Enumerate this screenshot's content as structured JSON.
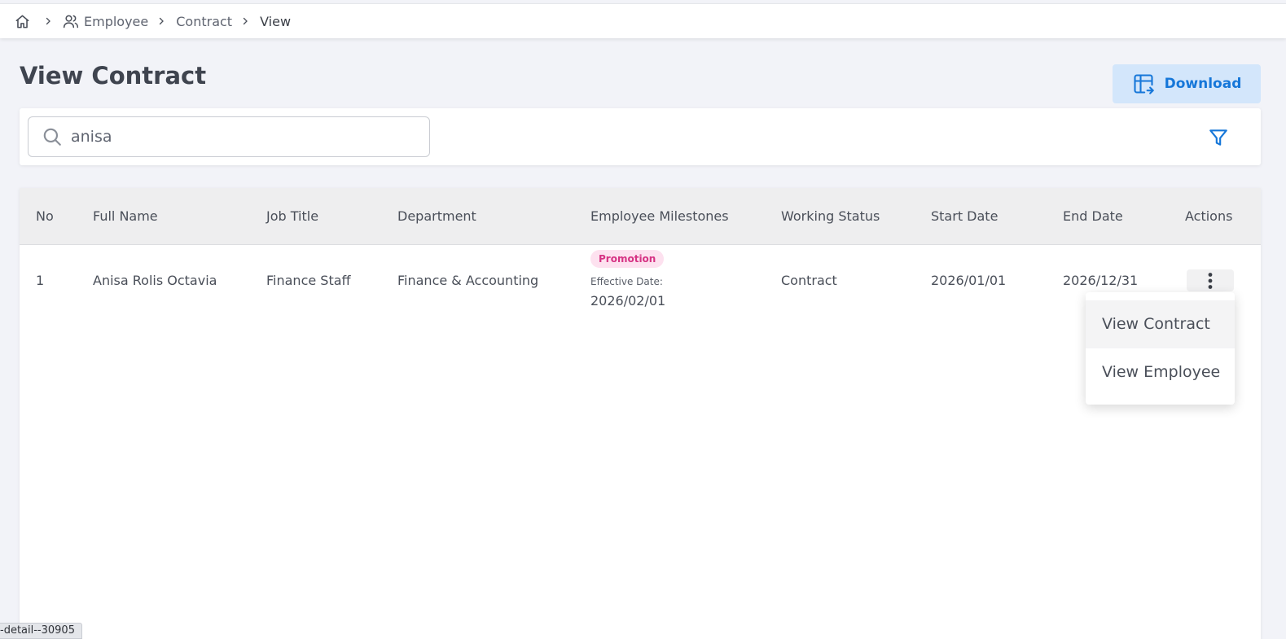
{
  "breadcrumb": {
    "items": [
      "Employee",
      "Contract"
    ],
    "current": "View"
  },
  "page": {
    "title": "View Contract",
    "download_label": "Download"
  },
  "search": {
    "value": "anisa"
  },
  "table": {
    "columns": [
      "No",
      "Full Name",
      "Job Title",
      "Department",
      "Employee Milestones",
      "Working Status",
      "Start Date",
      "End Date",
      "Actions"
    ],
    "rows": [
      {
        "no": "1",
        "full_name": "Anisa Rolis Octavia",
        "job_title": "Finance Staff",
        "department": "Finance & Accounting",
        "milestone_badge": "Promotion",
        "effective_label": "Effective Date:",
        "effective_date": "2026/02/01",
        "working_status": "Contract",
        "start_date": "2026/01/01",
        "end_date": "2026/12/31"
      }
    ]
  },
  "actions_menu": {
    "items": [
      "View Contract",
      "View Employee"
    ]
  },
  "status_bar": {
    "url_fragment": "-detail--30905"
  },
  "colors": {
    "accent": "#1677d9",
    "badge_bg": "#fde1ef",
    "badge_text": "#d63384"
  },
  "icons": [
    "home-icon",
    "chevron-right-icon",
    "users-icon",
    "search-icon",
    "filter-icon",
    "table-export-icon",
    "more-vertical-icon"
  ]
}
